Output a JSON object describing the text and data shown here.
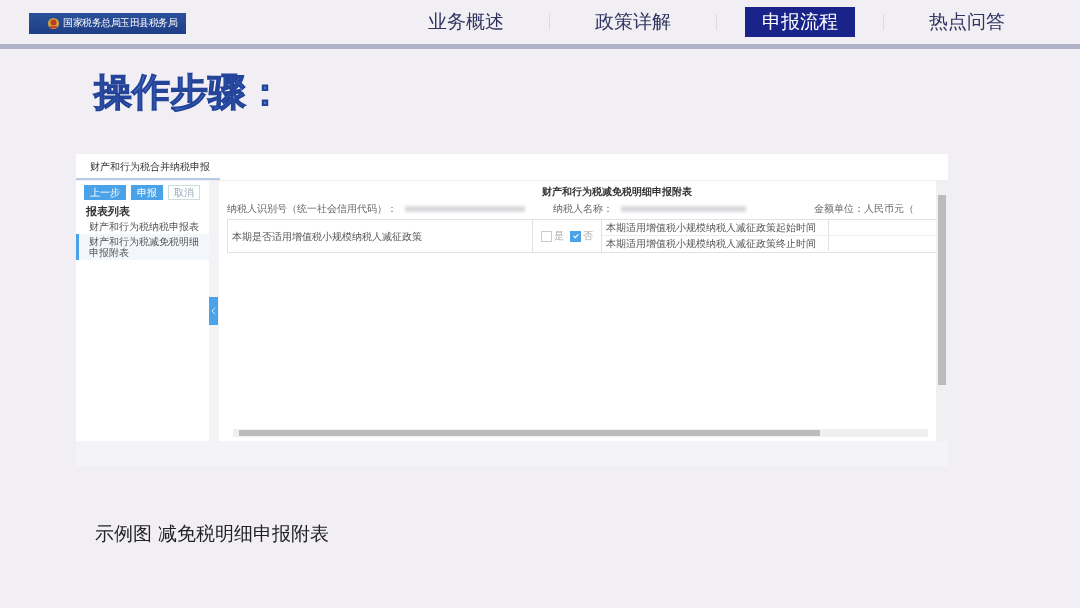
{
  "header": {
    "logo_text": "国家税务总局玉田县税务局",
    "nav": [
      {
        "label": "业务概述",
        "selected": false
      },
      {
        "label": "政策详解",
        "selected": false
      },
      {
        "label": "申报流程",
        "selected": true
      },
      {
        "label": "热点问答",
        "selected": false
      }
    ]
  },
  "title": "操作步骤：",
  "screenshot": {
    "tabs": [
      {
        "label": "财产和行为税合并纳税申报",
        "selected": true
      }
    ],
    "buttons": [
      {
        "label": "上一步",
        "kind": "primary"
      },
      {
        "label": "申报",
        "kind": "primary"
      },
      {
        "label": "取消",
        "kind": "plain"
      }
    ],
    "list_title": "报表列表",
    "list_items": [
      {
        "label": "财产和行为税纳税申报表",
        "selected": false
      },
      {
        "label": "财产和行为税减免税明细申报附表",
        "selected": true
      }
    ],
    "form_title": "财产和行为税减免税明细申报附表",
    "taxpayer_id_label": "纳税人识别号（统一社会信用代码）：",
    "taxpayer_name_label": "纳税人名称：",
    "unit_label": "金额单位：人民币元（",
    "question": "本期是否适用增值税小规模纳税人减征政策",
    "options": [
      {
        "label": "是",
        "checked": false
      },
      {
        "label": "否",
        "checked": true
      }
    ],
    "date_rows": [
      "本期适用增值税小规模纳税人减征政策起始时间",
      "本期适用增值税小规模纳税人减征政策终止时间"
    ]
  },
  "caption": "示例图  减免税明细申报附表"
}
